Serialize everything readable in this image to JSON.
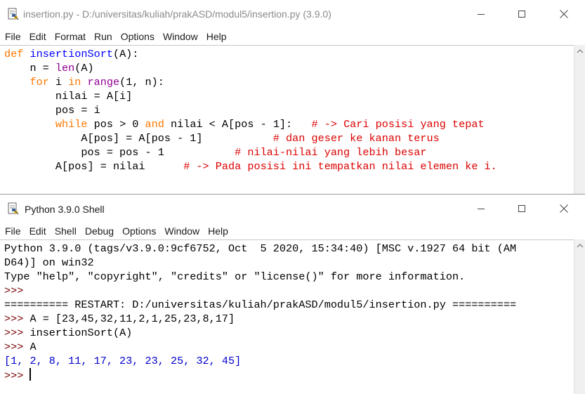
{
  "editor": {
    "title": "insertion.py - D:/universitas/kuliah/prakASD/modul5/insertion.py (3.9.0)",
    "menu": [
      "File",
      "Edit",
      "Format",
      "Run",
      "Options",
      "Window",
      "Help"
    ],
    "code": [
      [
        {
          "t": "def ",
          "c": "kw"
        },
        {
          "t": "insertionSort",
          "c": "fn"
        },
        {
          "t": "(A):",
          "c": ""
        }
      ],
      [
        {
          "t": "    n = ",
          "c": ""
        },
        {
          "t": "len",
          "c": "bi"
        },
        {
          "t": "(A)",
          "c": ""
        }
      ],
      [
        {
          "t": "    ",
          "c": ""
        },
        {
          "t": "for",
          "c": "kw"
        },
        {
          "t": " i ",
          "c": ""
        },
        {
          "t": "in",
          "c": "kw"
        },
        {
          "t": " ",
          "c": ""
        },
        {
          "t": "range",
          "c": "bi"
        },
        {
          "t": "(1, n):",
          "c": ""
        }
      ],
      [
        {
          "t": "        nilai = A[i]",
          "c": ""
        }
      ],
      [
        {
          "t": "        pos = i",
          "c": ""
        }
      ],
      [
        {
          "t": "        ",
          "c": ""
        },
        {
          "t": "while",
          "c": "kw"
        },
        {
          "t": " pos > 0 ",
          "c": ""
        },
        {
          "t": "and",
          "c": "kw"
        },
        {
          "t": " nilai < A[pos - 1]:   ",
          "c": ""
        },
        {
          "t": "# -> Cari posisi yang tepat",
          "c": "cm"
        }
      ],
      [
        {
          "t": "            A[pos] = A[pos - 1]           ",
          "c": ""
        },
        {
          "t": "# dan geser ke kanan terus",
          "c": "cm"
        }
      ],
      [
        {
          "t": "            pos = pos - 1           ",
          "c": ""
        },
        {
          "t": "# nilai-nilai yang lebih besar",
          "c": "cm"
        }
      ],
      [
        {
          "t": "        A[pos] = nilai      ",
          "c": ""
        },
        {
          "t": "# -> Pada posisi ini tempatkan nilai elemen ke i.",
          "c": "cm"
        }
      ]
    ]
  },
  "shell": {
    "title": "Python 3.9.0 Shell",
    "menu": [
      "File",
      "Edit",
      "Shell",
      "Debug",
      "Options",
      "Window",
      "Help"
    ],
    "lines": [
      [
        {
          "t": "Python 3.9.0 (tags/v3.9.0:9cf6752, Oct  5 2020, 15:34:40) [MSC v.1927 64 bit (AM",
          "c": ""
        }
      ],
      [
        {
          "t": "D64)] on win32",
          "c": ""
        }
      ],
      [
        {
          "t": "Type \"help\", \"copyright\", \"credits\" or \"license()\" for more information.",
          "c": ""
        }
      ],
      [
        {
          "t": ">>> ",
          "c": "prompt"
        }
      ],
      [
        {
          "t": "========== RESTART: D:/universitas/kuliah/prakASD/modul5/insertion.py ==========",
          "c": ""
        }
      ],
      [
        {
          "t": ">>> ",
          "c": "prompt"
        },
        {
          "t": "A = [23,45,32,11,2,1,25,23,8,17]",
          "c": ""
        }
      ],
      [
        {
          "t": ">>> ",
          "c": "prompt"
        },
        {
          "t": "insertionSort(A)",
          "c": ""
        }
      ],
      [
        {
          "t": ">>> ",
          "c": "prompt"
        },
        {
          "t": "A",
          "c": ""
        }
      ],
      [
        {
          "t": "[1, 2, 8, 11, 17, 23, 23, 25, 32, 45]",
          "c": "out"
        }
      ],
      [
        {
          "t": ">>> ",
          "c": "prompt"
        }
      ]
    ]
  }
}
